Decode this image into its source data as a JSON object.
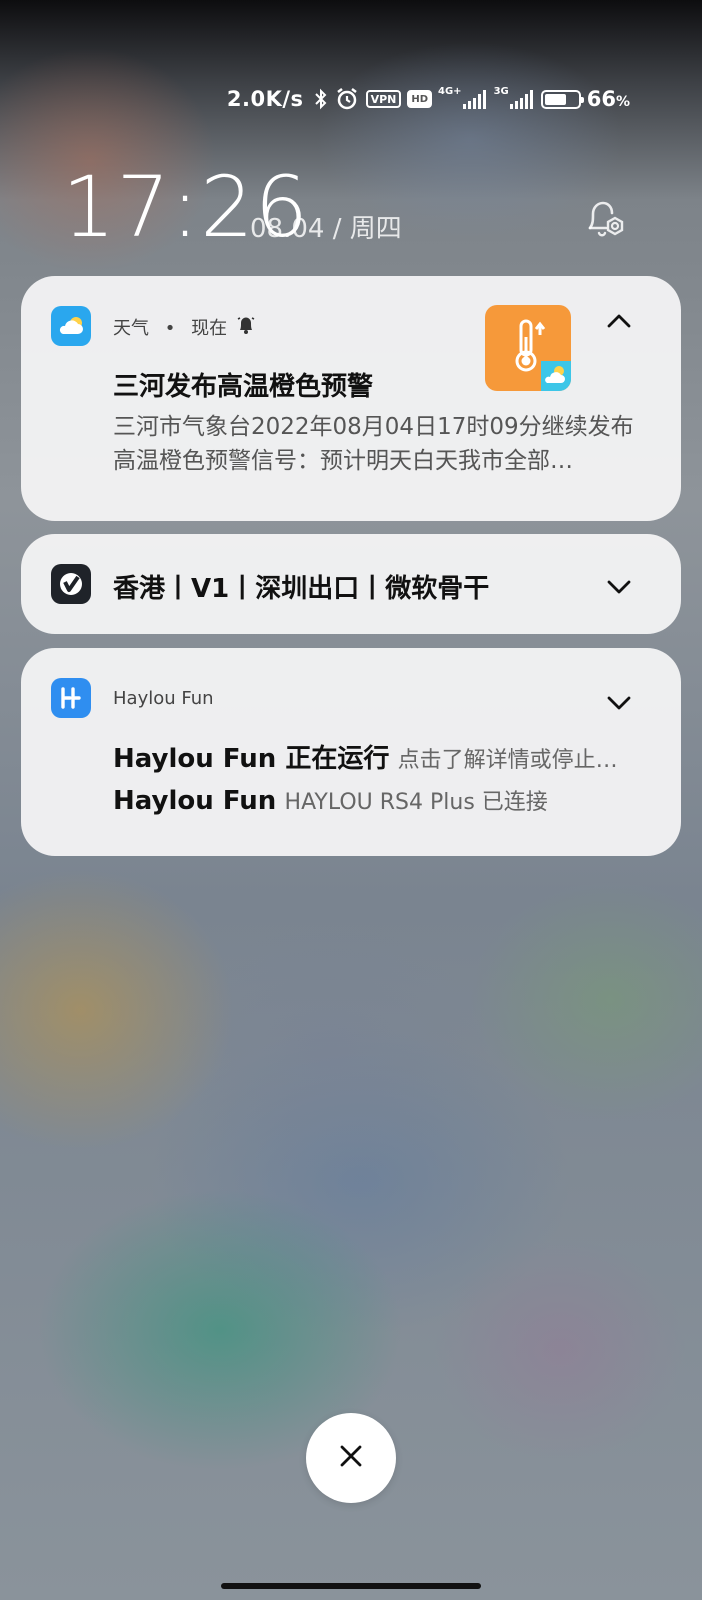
{
  "status_bar": {
    "net_speed": "2.0K/s",
    "vpn_label": "VPN",
    "hd_label": "HD",
    "net1_label": "4G+",
    "net2_label": "3G",
    "battery_percent": "66",
    "battery_unit": "%",
    "battery_level": 0.66,
    "icons": [
      "bluetooth-icon",
      "alarm-icon",
      "vpn-icon",
      "hd-icon",
      "signal-4g-icon",
      "signal-3g-icon",
      "battery-icon"
    ]
  },
  "lockscreen": {
    "time": "17:26",
    "date": "08.04 / 周四"
  },
  "notifications": [
    {
      "app": "天气",
      "separator": "•",
      "when": "现在",
      "title": "三河发布高温橙色预警",
      "body": "三河市气象台2022年08月04日17时09分继续发布高温橙色预警信号：预计明天白天我市全部…",
      "expanded": true,
      "colors": {
        "icon_bg": "#2aa7ee",
        "thumb_bg": "#f6993a"
      }
    },
    {
      "title": "香港丨V1丨深圳出口丨微软骨干",
      "expanded": false
    },
    {
      "app": "Haylou Fun",
      "rows": [
        {
          "name": "Haylou Fun 正在运行",
          "detail": "点击了解详情或停止…"
        },
        {
          "name": "Haylou Fun",
          "detail": "HAYLOU RS4 Plus 已连接"
        }
      ],
      "expanded": false,
      "colors": {
        "icon_bg": "#2f8ef0"
      }
    }
  ],
  "dismiss_icon": "close-icon"
}
